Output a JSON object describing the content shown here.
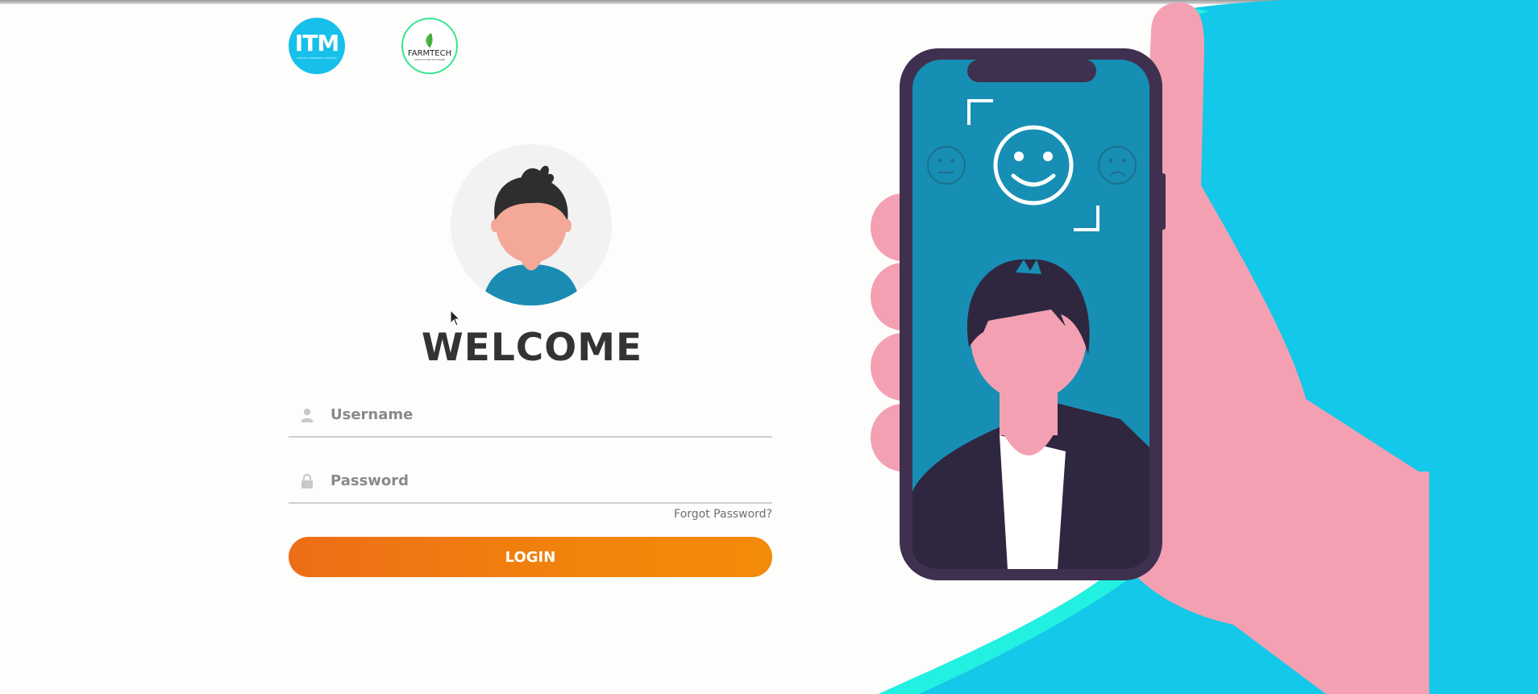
{
  "logos": {
    "itm": {
      "text": "ITM",
      "tagline": "UNLOCK TOMORROW'S GROWTH"
    },
    "farmtech": {
      "text": "FARMTECH",
      "tagline": "AGRICULTURE SOFTWARE"
    }
  },
  "heading": "WELCOME",
  "form": {
    "username": {
      "placeholder": "Username",
      "value": ""
    },
    "password": {
      "placeholder": "Password",
      "value": ""
    },
    "forgot_label": "Forgot Password?",
    "login_label": "LOGIN"
  },
  "colors": {
    "accent": "#f1840c",
    "illustration_blue": "#13c8e9",
    "phone_screen": "#178fb4",
    "hand": "#f4a0b3",
    "phone_frame": "#3f3050"
  },
  "icons": [
    "user-icon",
    "lock-icon",
    "smiley-icon",
    "neutral-face-icon",
    "sad-face-icon",
    "cursor-icon"
  ]
}
